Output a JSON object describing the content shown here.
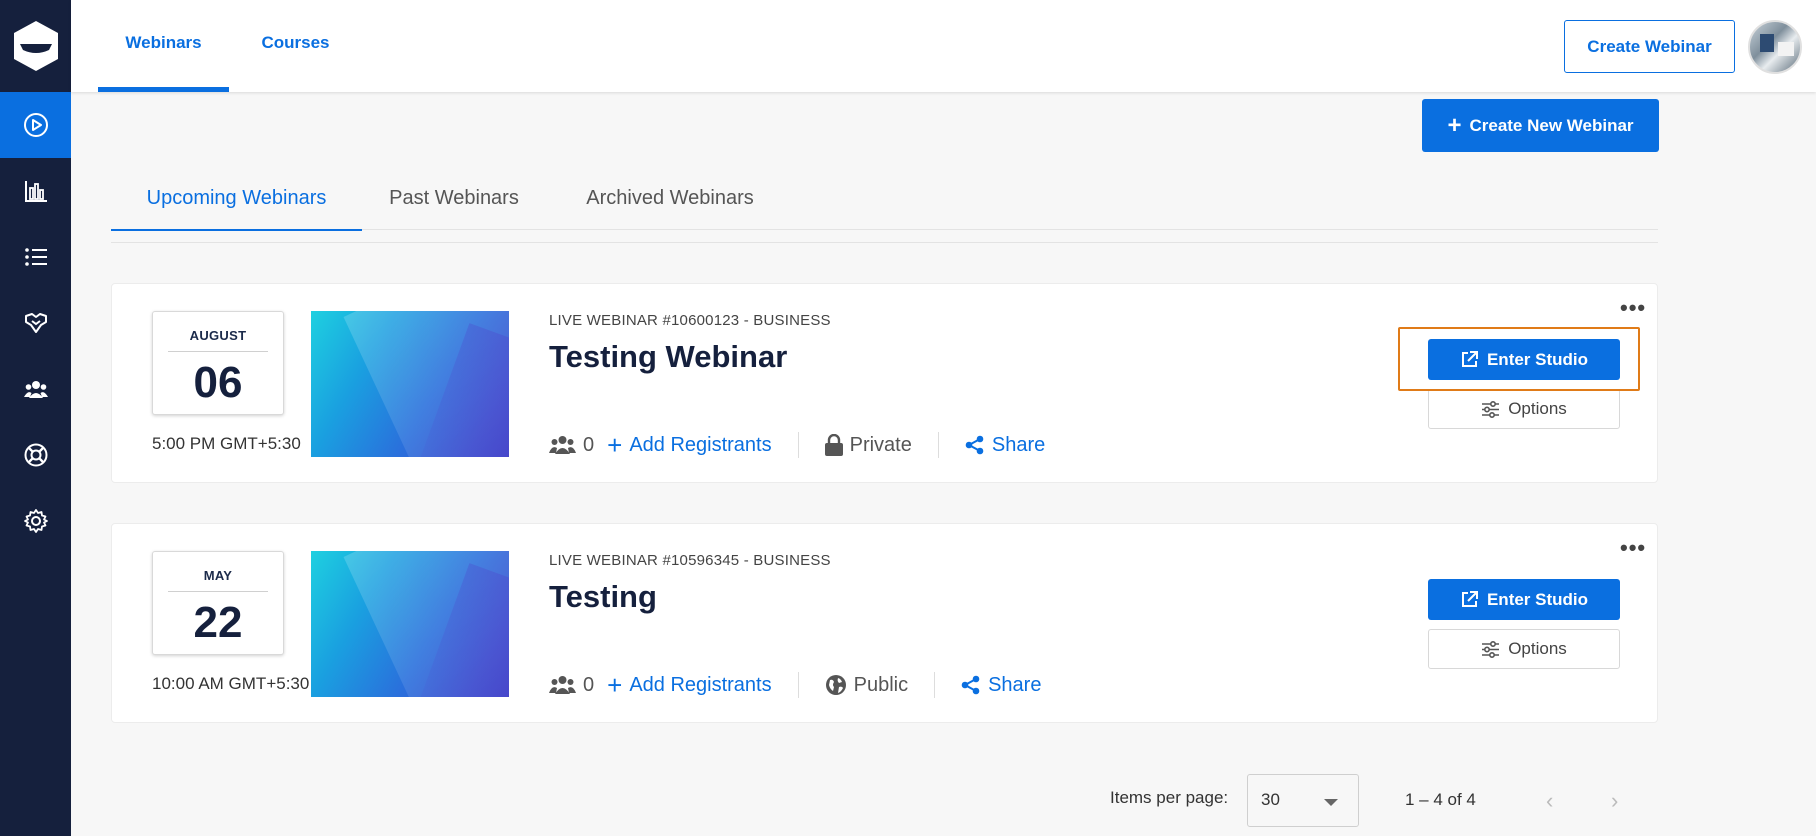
{
  "topbar": {
    "tabs": [
      {
        "label": "Webinars",
        "active": true
      },
      {
        "label": "Courses",
        "active": false
      }
    ],
    "create_button": "Create Webinar"
  },
  "sidebar": {
    "items": [
      {
        "icon": "play-circle-icon",
        "active": true
      },
      {
        "icon": "bar-chart-icon",
        "active": false
      },
      {
        "icon": "list-icon",
        "active": false
      },
      {
        "icon": "integrations-icon",
        "active": false
      },
      {
        "icon": "users-icon",
        "active": false
      },
      {
        "icon": "lifebuoy-icon",
        "active": false
      },
      {
        "icon": "gear-icon",
        "active": false
      }
    ]
  },
  "main": {
    "create_new_label": "Create New Webinar",
    "subtabs": [
      {
        "label": "Upcoming Webinars",
        "active": true
      },
      {
        "label": "Past Webinars",
        "active": false
      },
      {
        "label": "Archived Webinars",
        "active": false
      }
    ],
    "webinars": [
      {
        "month": "AUGUST",
        "day": "06",
        "time": "5:00 PM GMT+5:30",
        "type": "LIVE WEBINAR #10600123 - BUSINESS",
        "title": "Testing Webinar",
        "registrants": "0",
        "add_registrants": "Add Registrants",
        "privacy": "Private",
        "privacy_icon": "lock-icon",
        "share": "Share",
        "enter_studio": "Enter Studio",
        "options": "Options"
      },
      {
        "month": "MAY",
        "day": "22",
        "time": "10:00 AM GMT+5:30",
        "type": "LIVE WEBINAR #10596345 - BUSINESS",
        "title": "Testing",
        "registrants": "0",
        "add_registrants": "Add Registrants",
        "privacy": "Public",
        "privacy_icon": "globe-icon",
        "share": "Share",
        "enter_studio": "Enter Studio",
        "options": "Options"
      }
    ],
    "pagination": {
      "items_per_page_label": "Items per page:",
      "items_per_page": "30",
      "range": "1 – 4 of 4"
    }
  },
  "colors": {
    "accent": "#0a6fe0",
    "sidebar": "#15203d",
    "highlight": "#e07b18"
  }
}
